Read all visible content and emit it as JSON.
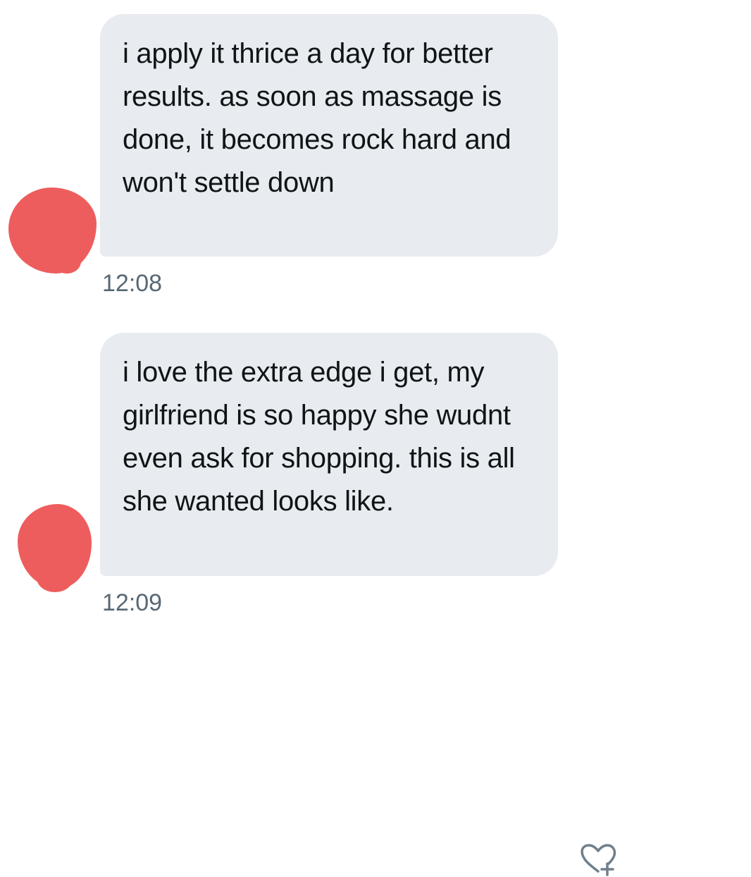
{
  "conversation": {
    "messages": [
      {
        "text": "i apply it thrice a day for better results. as soon as massage is done, it becomes rock hard and won't settle down",
        "time": "12:08"
      },
      {
        "text": "i love the extra edge i get, my girlfriend is so happy she wudnt even ask for shopping. this is all she wanted looks like.",
        "time": "12:09"
      }
    ]
  },
  "icons": {
    "avatar_icon": "avatar-redacted",
    "like_icon": "heart-plus-icon"
  },
  "colors": {
    "bubble_background": "#e8ebef",
    "message_text": "#111417",
    "timestamp_text": "#586874",
    "redaction": "#ee5d5d",
    "icon_stroke": "#6f7f8c"
  }
}
